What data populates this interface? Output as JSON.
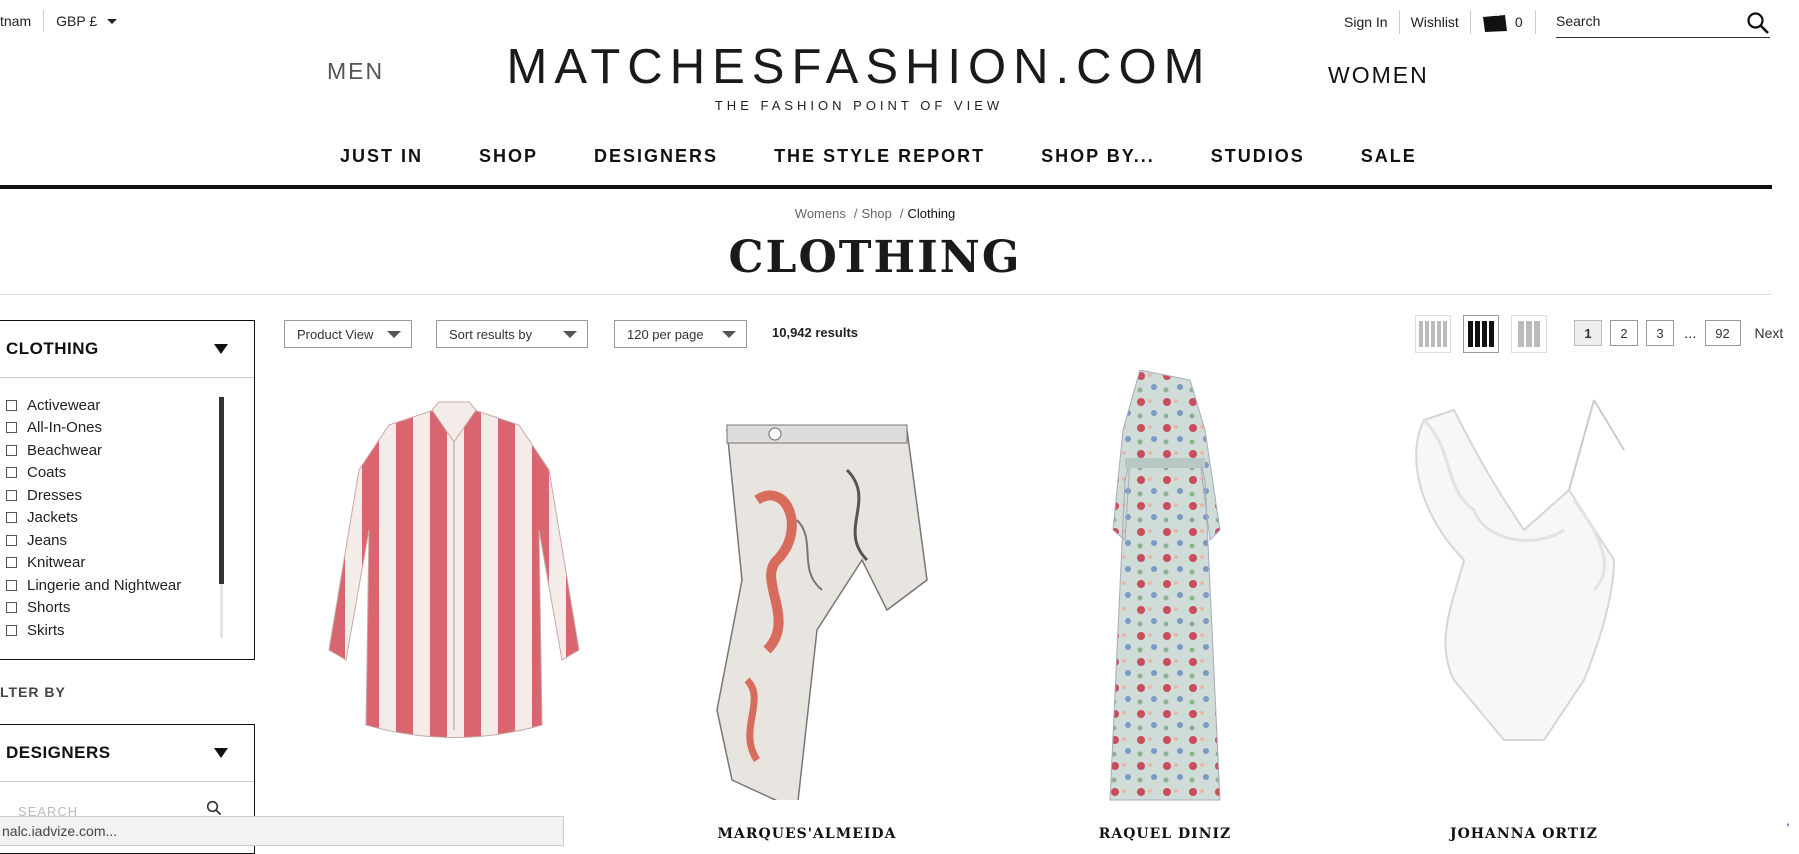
{
  "topbar": {
    "country": "tnam",
    "currency": "GBP £",
    "sign_in": "Sign In",
    "wishlist": "Wishlist",
    "bag_count": "0",
    "search_placeholder": "Search"
  },
  "brand": {
    "men": "MEN",
    "women": "WOMEN",
    "logo": "MATCHESFASHION.COM",
    "tagline": "THE FASHION POINT OF VIEW"
  },
  "nav": [
    "JUST IN",
    "SHOP",
    "DESIGNERS",
    "THE STYLE REPORT",
    "SHOP BY...",
    "STUDIOS",
    "SALE"
  ],
  "breadcrumb": {
    "items": [
      "Womens",
      "Shop"
    ],
    "current": "Clothing"
  },
  "page_title": "CLOTHING",
  "sidebar": {
    "category_title": "CLOTHING",
    "categories": [
      "Activewear",
      "All-In-Ones",
      "Beachwear",
      "Coats",
      "Dresses",
      "Jackets",
      "Jeans",
      "Knitwear",
      "Lingerie and Nightwear",
      "Shorts",
      "Skirts"
    ],
    "filter_by": "LTER BY",
    "designers_title": "DESIGNERS",
    "designer_search_placeholder": "SEARCH"
  },
  "toolbar": {
    "product_view": "Product View",
    "sort": "Sort results by",
    "per_page": "120 per page",
    "results": "10,942 results",
    "pages": [
      "1",
      "2",
      "3"
    ],
    "ellipsis": "...",
    "last_page": "92",
    "next": "Next"
  },
  "products": [
    {
      "designer": ""
    },
    {
      "designer": "MARQUES'ALMEIDA"
    },
    {
      "designer": "RAQUEL DINIZ"
    },
    {
      "designer": "JOHANNA ORTIZ"
    }
  ],
  "status_bar": "nalc.iadvize.com..."
}
